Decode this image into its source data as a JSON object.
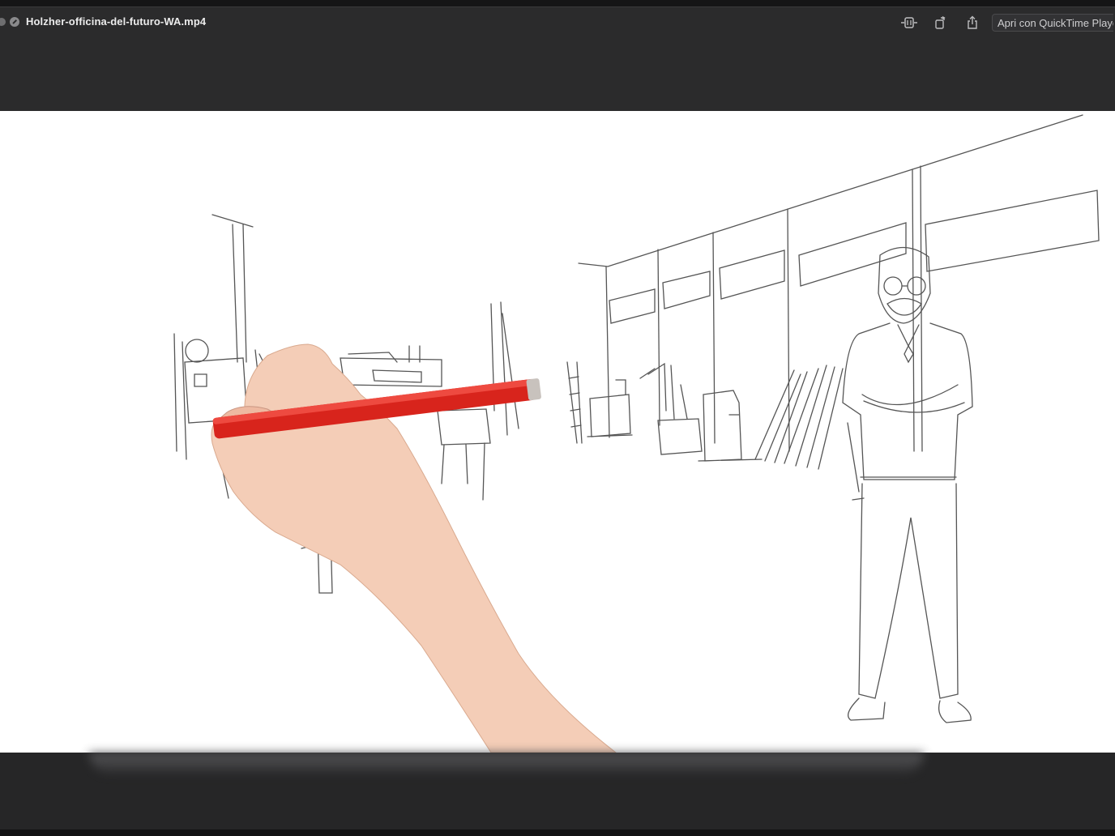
{
  "window": {
    "file_title": "Holzher-officina-del-futuro-WA.mp4",
    "open_with_label": "Apri con QuickTime Player"
  },
  "toolbar": {
    "icons": [
      "trim-icon",
      "rotate-icon",
      "share-icon"
    ]
  },
  "colors": {
    "titlebar": "#2b2b2c",
    "video_background": "#ffffff",
    "pencil": "#d8241c"
  }
}
